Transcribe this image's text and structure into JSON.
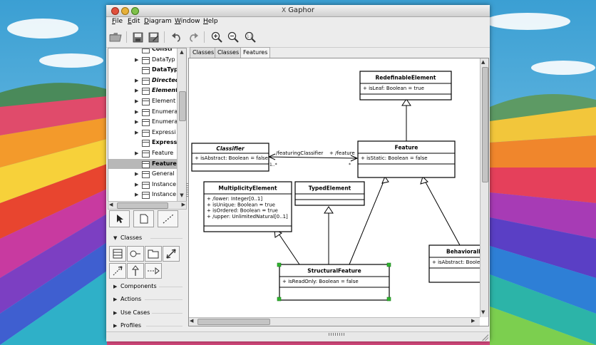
{
  "window": {
    "title": "Gaphor"
  },
  "menu": [
    "File",
    "Edit",
    "Diagram",
    "Window",
    "Help"
  ],
  "menu_mnemonics": [
    "F",
    "E",
    "D",
    "W",
    "H"
  ],
  "toolbar": {
    "buttons": [
      "open-folder-icon",
      "save-icon",
      "save-as-icon",
      "undo-icon",
      "redo-icon",
      "zoom-in-icon",
      "zoom-out-icon",
      "zoom-100-icon"
    ]
  },
  "tree": {
    "items": [
      {
        "label": "Constr",
        "bold": true,
        "italic": false,
        "expander": false
      },
      {
        "label": "DataTyp",
        "bold": false,
        "italic": false,
        "expander": true
      },
      {
        "label": "DataTyp",
        "bold": true,
        "italic": false,
        "expander": false
      },
      {
        "label": "Directed",
        "bold": true,
        "italic": true,
        "expander": true
      },
      {
        "label": "Element",
        "bold": true,
        "italic": true,
        "expander": true
      },
      {
        "label": "Element",
        "bold": false,
        "italic": false,
        "expander": true
      },
      {
        "label": "Enumera",
        "bold": false,
        "italic": false,
        "expander": true
      },
      {
        "label": "Enumera",
        "bold": false,
        "italic": false,
        "expander": true
      },
      {
        "label": "Expressi",
        "bold": false,
        "italic": false,
        "expander": true
      },
      {
        "label": "Express",
        "bold": true,
        "italic": false,
        "expander": false
      },
      {
        "label": "Feature",
        "bold": false,
        "italic": false,
        "expander": true
      },
      {
        "label": "Feature",
        "bold": true,
        "italic": false,
        "expander": false,
        "selected": true
      },
      {
        "label": "General",
        "bold": false,
        "italic": false,
        "expander": true
      },
      {
        "label": "Instance",
        "bold": false,
        "italic": false,
        "expander": true
      },
      {
        "label": "Instance",
        "bold": false,
        "italic": false,
        "expander": true
      }
    ]
  },
  "toolbox": {
    "sections": [
      {
        "label": "Classes",
        "expanded": true
      },
      {
        "label": "Components",
        "expanded": false
      },
      {
        "label": "Actions",
        "expanded": false
      },
      {
        "label": "Use Cases",
        "expanded": false
      },
      {
        "label": "Profiles",
        "expanded": false
      }
    ]
  },
  "tabs": [
    {
      "label": "Classes",
      "active": false
    },
    {
      "label": "Classes",
      "active": false
    },
    {
      "label": "Features",
      "active": true
    }
  ],
  "diagram": {
    "classes": {
      "redefinable": {
        "name": "RedefinableElement",
        "attrs": [
          "+ isLeaf: Boolean = true"
        ]
      },
      "feature": {
        "name": "Feature",
        "attrs": [
          "+ isStatic: Boolean = false"
        ]
      },
      "classifier": {
        "name": "Classifier",
        "attrs": [
          "+ isAbstract: Boolean = false"
        ]
      },
      "multiplicity": {
        "name": "MultiplicityElement",
        "attrs": [
          "+ /lower: Integer[0..1]",
          "+ isUnique: Boolean = true",
          "+ isOrdered: Boolean = true",
          "+ /upper: UnlimitedNatural[0..1]"
        ]
      },
      "typed": {
        "name": "TypedElement",
        "attrs": []
      },
      "structural": {
        "name": "StructuralFeature",
        "attrs": [
          "+ isReadOnly: Boolean = false"
        ]
      },
      "behavioral": {
        "name": "BehavioralF",
        "attrs": [
          "+ isAbstract: Boolea"
        ]
      }
    },
    "association": {
      "end1_label": "/featuringClassifier",
      "end2_label": "+ /feature",
      "end1_mult": "1..*",
      "end2_mult": "*"
    }
  },
  "colors": {
    "selection_handle": "#2fb52f",
    "selected_row": "#b8b8b8"
  }
}
